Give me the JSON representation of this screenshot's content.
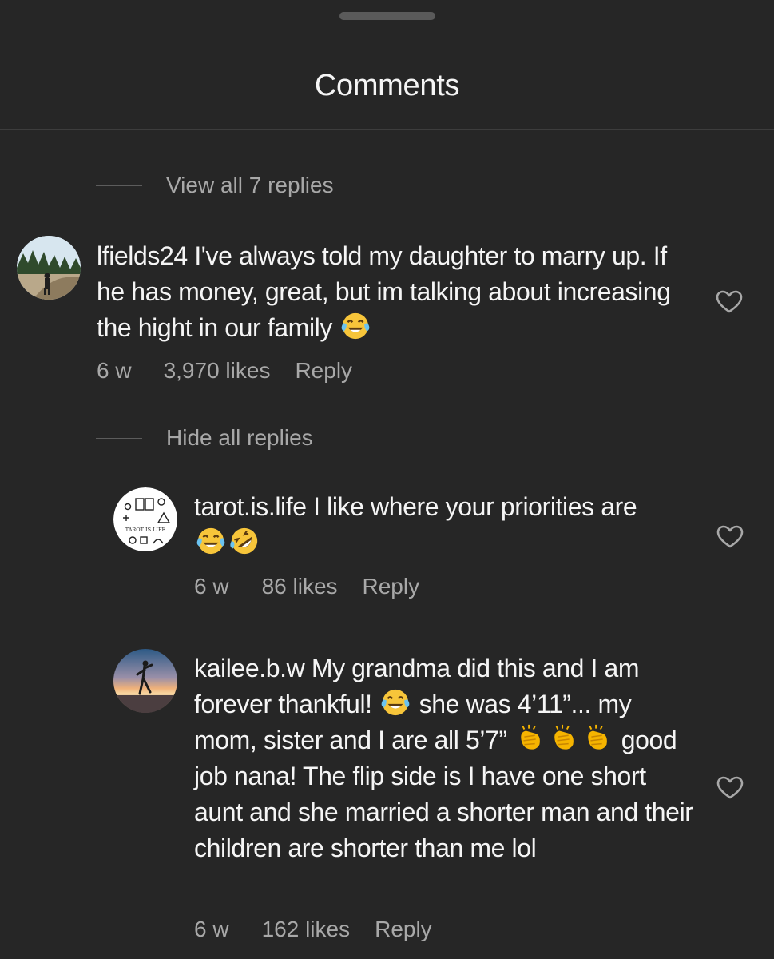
{
  "header": {
    "title": "Comments"
  },
  "thread": {
    "view_replies_label": "View all 7 replies",
    "hide_replies_label": "Hide all replies"
  },
  "comments": [
    {
      "username": "lfields24",
      "text": "I've always told my daughter to marry up. If he has money, great, but im talking about increasing the hight in our family",
      "emojis": [
        "face-with-tears-of-joy"
      ],
      "age": "6 w",
      "likes": "3,970 likes",
      "reply_label": "Reply"
    },
    {
      "username": "tarot.is.life",
      "text": "I like where your priorities are",
      "emojis": [
        "face-with-tears-of-joy",
        "rolling-on-the-floor-laughing"
      ],
      "age": "6 w",
      "likes": "86 likes",
      "reply_label": "Reply",
      "avatar_label": "TAROT IS LIFE"
    },
    {
      "username": "kailee.b.w",
      "text_part1": "My grandma did this and I am forever thankful!",
      "text_part2": "she was 4’11”... my mom, sister and I are all 5’7”",
      "text_part3": "good job nana! The flip side is I have one short aunt and she married a shorter man and their children are shorter than me lol",
      "emojis": [
        "face-with-tears-of-joy",
        "clapping-hands",
        "clapping-hands",
        "clapping-hands"
      ],
      "age": "6 w",
      "likes": "162 likes",
      "reply_label": "Reply"
    }
  ],
  "colors": {
    "background": "#262626",
    "primary_text": "#f5f5f5",
    "secondary_text": "#a8a8a8",
    "divider": "#3d3d3d"
  }
}
